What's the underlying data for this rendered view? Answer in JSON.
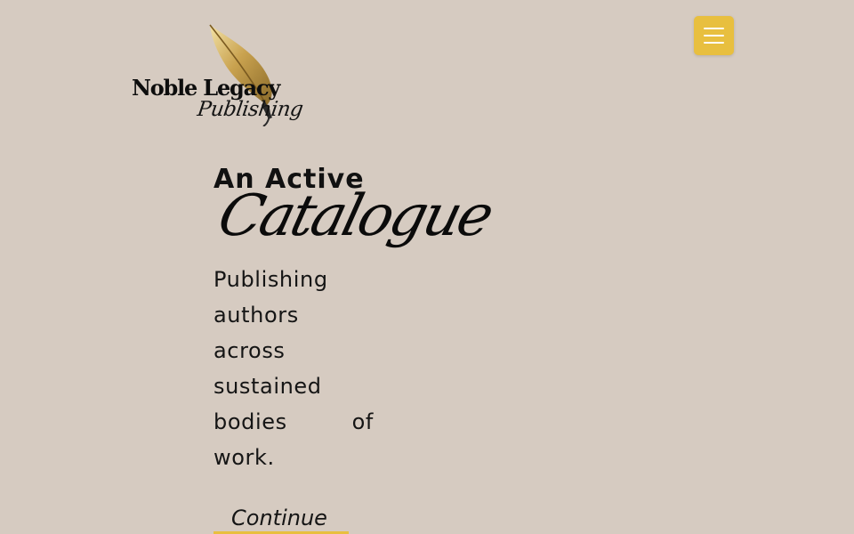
{
  "logo": {
    "name": "Noble Legacy",
    "subtitle": "Publishing",
    "icon": "quill-feather-icon"
  },
  "header": {
    "menu_icon": "hamburger-menu-icon",
    "menu_color": "#e8bf3f"
  },
  "hero": {
    "title": "An Active",
    "script_title": "Catalogue",
    "body": "Publishing authors across sustained bodies of work.",
    "cta_label": "Continue"
  },
  "colors": {
    "background": "#d6cbc1",
    "accent": "#e8bf3f"
  }
}
